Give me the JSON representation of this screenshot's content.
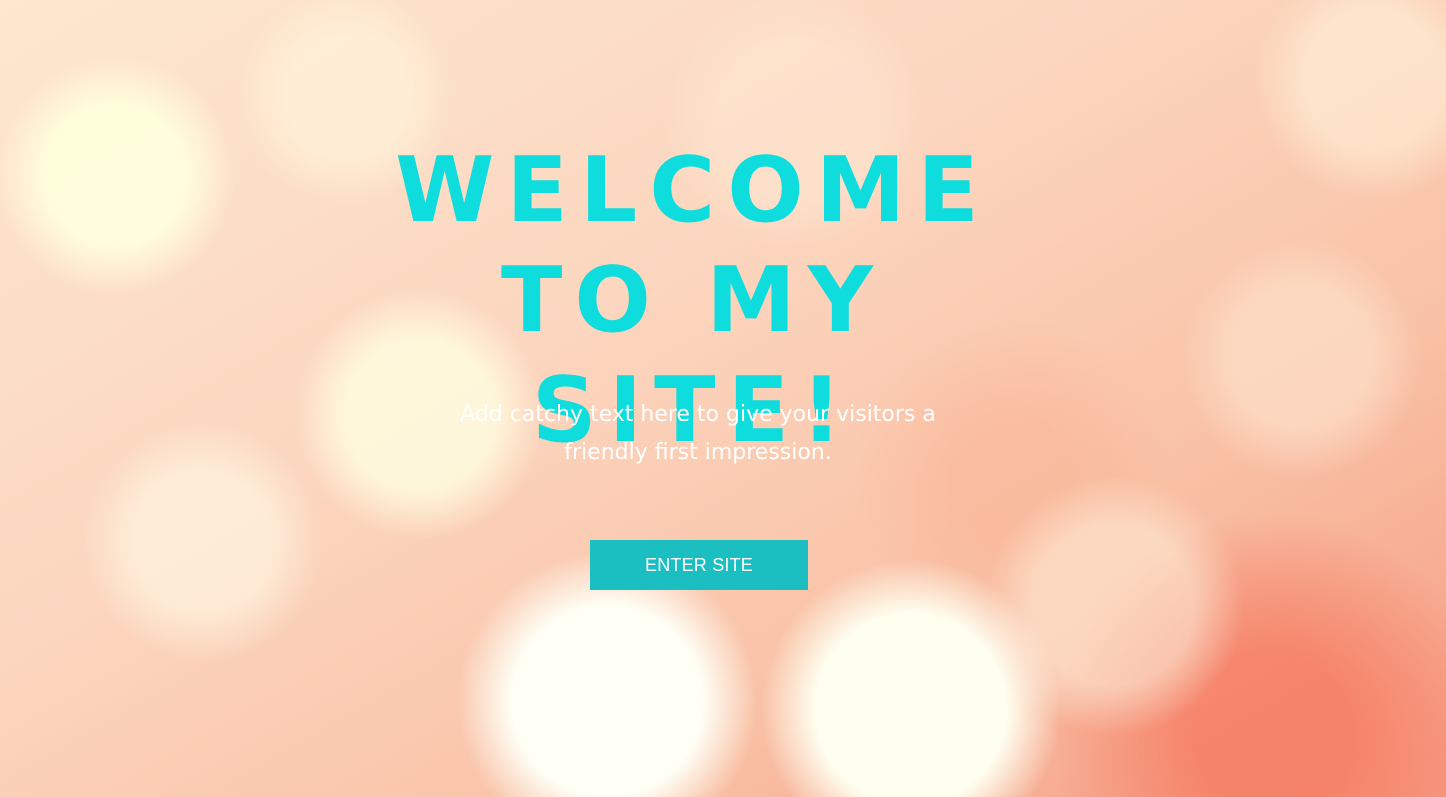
{
  "hero": {
    "headline_line1": "WELCOME",
    "headline_line2": "TO MY SITE!",
    "tagline_line1": "Add catchy text here to give your visitors a",
    "tagline_line2": "friendly first impression.",
    "cta_label": "ENTER SITE"
  },
  "colors": {
    "headline": "#0fdcdc",
    "button_bg": "#1bbec1",
    "button_text": "#ffffff",
    "tagline": "#ffffff",
    "background_base": "#fcd6bf"
  }
}
